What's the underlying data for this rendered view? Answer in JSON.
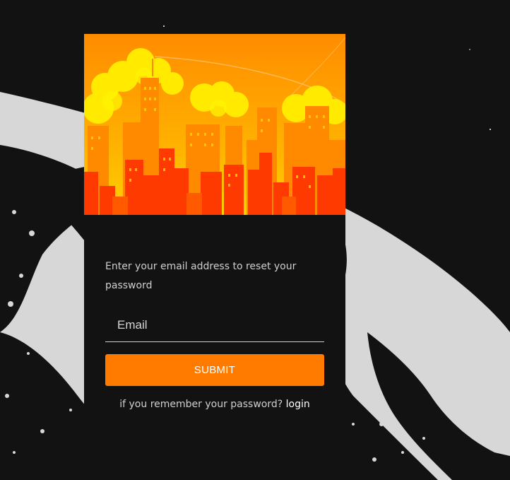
{
  "reset_form": {
    "instructions": "Enter your email address to reset your password",
    "email_placeholder": "Email",
    "email_value": "",
    "submit_label": "SUBMIT",
    "remember_text": "if you remember your password?",
    "login_link_label": "login"
  },
  "theme": {
    "page_background": "#121212",
    "accent": "#ff7b00",
    "planet_color": "#d6d6d6"
  },
  "icons": {
    "hero_image": "city-skyline-illustration",
    "background": "planet-surface-in-space"
  }
}
